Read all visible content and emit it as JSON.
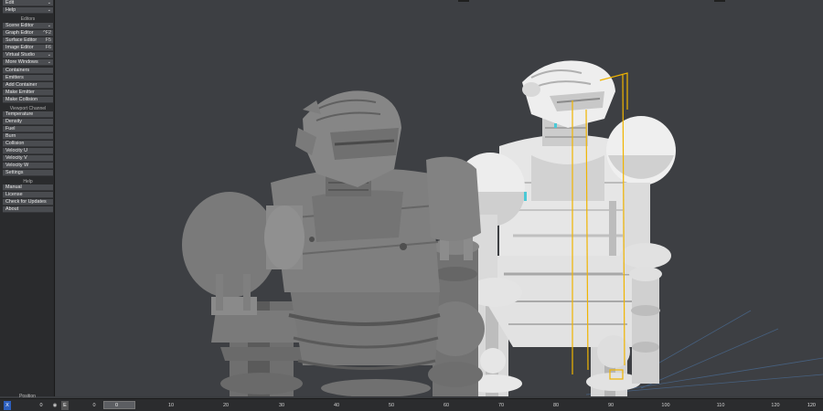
{
  "menu": {
    "top": [
      {
        "label": "Edit",
        "icon": "chevron-down"
      },
      {
        "label": "Help",
        "icon": "chevron-down"
      }
    ],
    "editors_label": "Editors",
    "editors": [
      {
        "label": "Scene Editor",
        "shortcut": "",
        "icon": "chevron-down"
      },
      {
        "label": "Graph Editor",
        "shortcut": "^F2",
        "icon": ""
      },
      {
        "label": "Surface Editor",
        "shortcut": "F5",
        "icon": ""
      },
      {
        "label": "Image Editor",
        "shortcut": "F6",
        "icon": ""
      },
      {
        "label": "Virtual Studio",
        "shortcut": "",
        "icon": "chevron-down"
      },
      {
        "label": "More Windows",
        "shortcut": "",
        "icon": "chevron-down"
      }
    ],
    "actions": [
      "Containers",
      "Emitters",
      "Add Container",
      "Make Emitter",
      "Make Collision"
    ],
    "viewport_channel_label": "Viewport Channel",
    "channels": [
      "Temperature",
      "Density",
      "Fuel",
      "Burn",
      "Collision",
      "Velocity U",
      "Velocity V",
      "Velocity W"
    ],
    "settings": "Settings",
    "help_label": "Help",
    "help_items": [
      "Manual",
      "License",
      "Check for Updates",
      "About"
    ],
    "footer": "Position"
  },
  "timeline": {
    "key_label": "X",
    "frame": "0",
    "e_label": "E",
    "current": "0",
    "ticks": [
      "0",
      "10",
      "20",
      "30",
      "40",
      "50",
      "60",
      "70",
      "80",
      "90",
      "100",
      "110",
      "120"
    ],
    "end": "120"
  },
  "colors": {
    "accent": "#2d5fbf",
    "selection": "#f0b400",
    "panel": "#2a2b2d",
    "viewport": "#3d3f43"
  }
}
